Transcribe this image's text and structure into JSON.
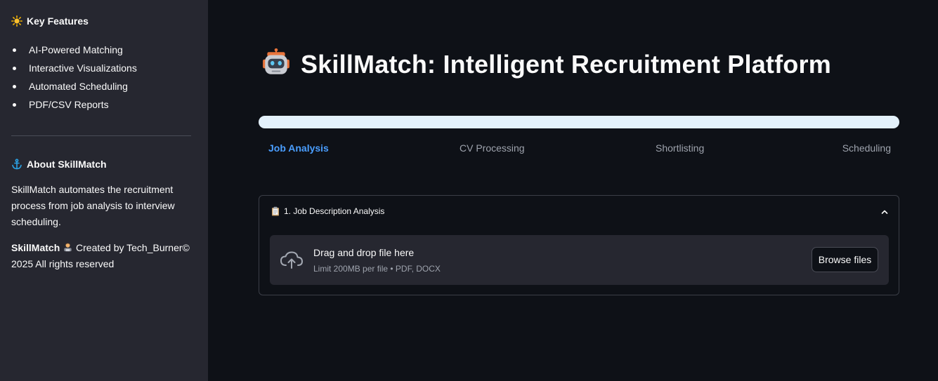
{
  "sidebar": {
    "features_heading": "Key Features",
    "features": [
      "AI-Powered Matching",
      "Interactive Visualizations",
      "Automated Scheduling",
      "PDF/CSV Reports"
    ],
    "about_heading": "About SkillMatch",
    "about_text": "SkillMatch automates the recruitment process from job analysis to interview scheduling.",
    "credit_brand": "SkillMatch",
    "credit_text": "Created by Tech_Burner© 2025 All rights reserved"
  },
  "main": {
    "title": "SkillMatch: Intelligent Recruitment Platform",
    "progress": 1.0,
    "steps": [
      "Job Analysis",
      "CV Processing",
      "Shortlisting",
      "Scheduling"
    ],
    "active_step": "Job Analysis",
    "expander": {
      "title": "1. Job Description Analysis",
      "dropzone_main": "Drag and drop file here",
      "dropzone_sub": "Limit 200MB per file • PDF, DOCX",
      "browse_label": "Browse files"
    }
  },
  "colors": {
    "accent": "#4a9eff",
    "progress_fill": "#e3f1fb",
    "background": "#0e1117",
    "sidebar_bg": "#262730"
  },
  "icons": {
    "features": "sun-icon",
    "about": "anchor-icon",
    "title": "robot-icon",
    "credit": "technologist-icon",
    "expander": "clipboard-icon",
    "upload": "cloud-upload-icon",
    "collapse": "chevron-up-icon"
  }
}
